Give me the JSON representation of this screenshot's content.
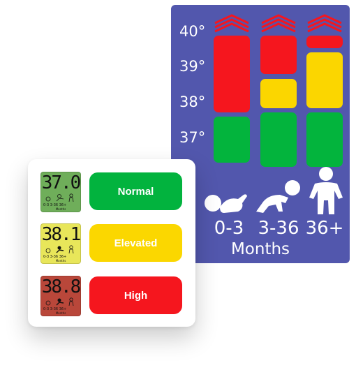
{
  "chart": {
    "temperature_labels": [
      "40°",
      "39°",
      "38°",
      "37°"
    ],
    "columns": [
      {
        "age": "0-3",
        "segments": [
          "green",
          "red"
        ]
      },
      {
        "age": "3-36",
        "segments": [
          "green",
          "yellow",
          "red"
        ]
      },
      {
        "age": "36+",
        "segments": [
          "green",
          "yellow",
          "red"
        ]
      }
    ],
    "months_label": "Months",
    "icons": [
      "infant-icon",
      "crawling-baby-icon",
      "child-icon"
    ]
  },
  "legend": {
    "rows": [
      {
        "reading": "37.0",
        "status": "Normal",
        "screen_color": "#6fae5a",
        "pill_color": "#02b33e",
        "text_color": "#ffffff"
      },
      {
        "reading": "38.1",
        "status": "Elevated",
        "screen_color": "#e8e65a",
        "pill_color": "#fbd700",
        "text_color": "#ffffff"
      },
      {
        "reading": "38.8",
        "status": "High",
        "screen_color": "#b9473a",
        "pill_color": "#f5161e",
        "text_color": "#ffffff"
      }
    ],
    "thermo_ages": "0-3 3-36 36+",
    "thermo_months": "Months"
  },
  "colors": {
    "panel": "#5257ad",
    "red": "#f5161e",
    "yellow": "#fbd600",
    "green": "#03b43d"
  }
}
